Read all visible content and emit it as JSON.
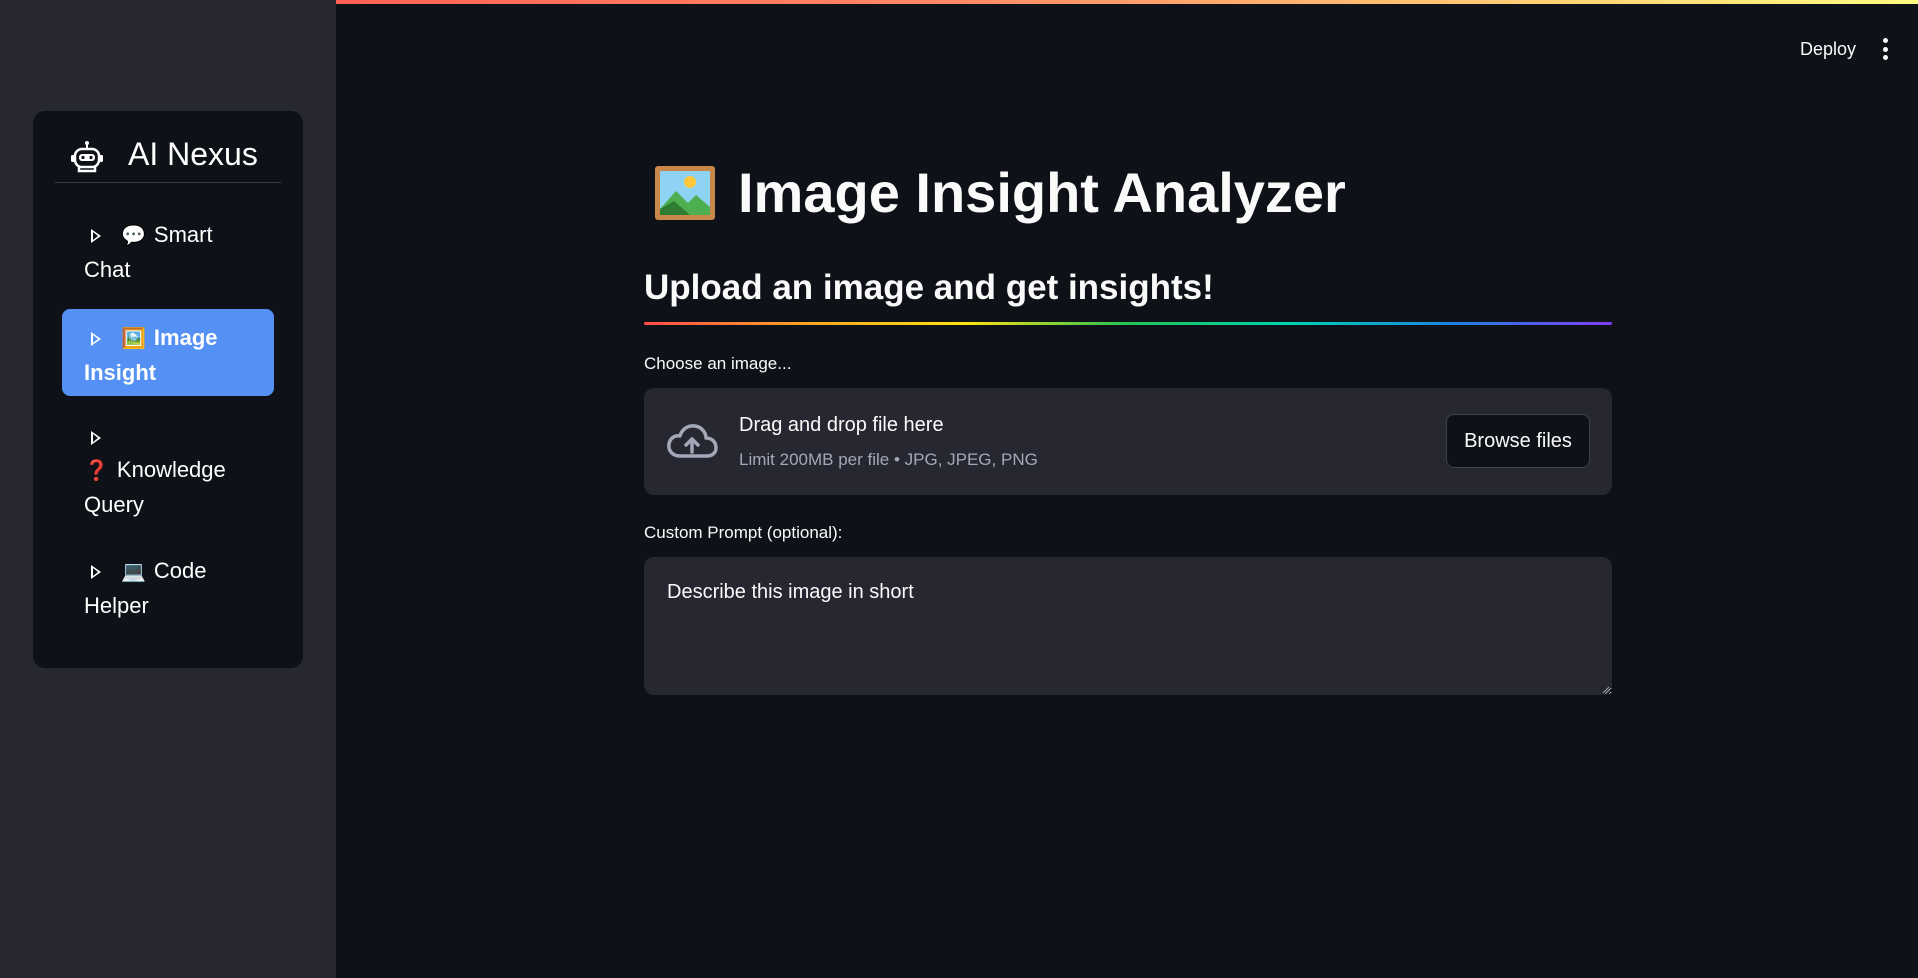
{
  "header": {
    "deploy_label": "Deploy",
    "menu_icon": "kebab-menu-icon"
  },
  "sidebar": {
    "brand": {
      "icon": "robot-icon",
      "title": "AI Nexus"
    },
    "items": [
      {
        "emoji": "💬",
        "label": "Smart Chat",
        "active": false
      },
      {
        "emoji": "🖼️",
        "label": "Image Insight",
        "active": true
      },
      {
        "emoji": "❓",
        "label": "Knowledge Query",
        "active": false
      },
      {
        "emoji": "💻",
        "label": "Code Helper",
        "active": false
      }
    ]
  },
  "main": {
    "title": "Image Insight Analyzer",
    "title_icon": "framed-picture-icon",
    "subtitle": "Upload an image and get insights!",
    "uploader": {
      "label": "Choose an image...",
      "drop_text": "Drag and drop file here",
      "limit_text": "Limit 200MB per file • JPG, JPEG, PNG",
      "browse_label": "Browse files",
      "icon": "cloud-upload-icon"
    },
    "prompt": {
      "label": "Custom Prompt (optional):",
      "value": "Describe this image in short"
    }
  },
  "colors": {
    "background": "#0e1117",
    "sidebar": "#262730",
    "active_item": "#5591f5",
    "input_bg": "#262730"
  }
}
